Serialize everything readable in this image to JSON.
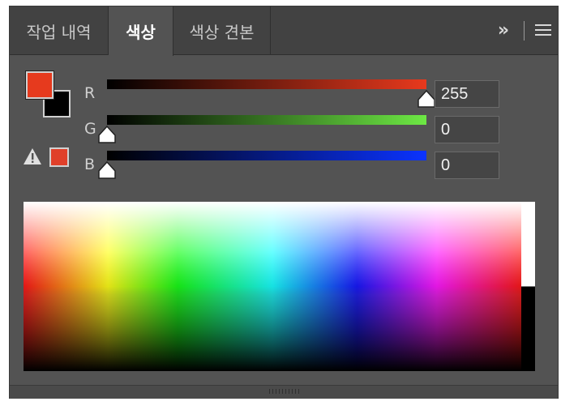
{
  "tabs": [
    {
      "label": "작업 내역",
      "active": false
    },
    {
      "label": "색상",
      "active": true
    },
    {
      "label": "색상 견본",
      "active": false
    }
  ],
  "header_icons": {
    "collapse": "double-chevron-right-icon",
    "menu": "hamburger-menu-icon"
  },
  "swatches": {
    "foreground_color": "#e63a1e",
    "background_color": "#000000",
    "gamut_warning_icon": "warning-triangle-icon",
    "gamut_color": "#e0402a"
  },
  "channels": [
    {
      "label": "R",
      "value": "255",
      "level": 1.0,
      "end_color": "#e8391d"
    },
    {
      "label": "G",
      "value": "0",
      "level": 0.0,
      "end_color": "#6de844"
    },
    {
      "label": "B",
      "value": "0",
      "level": 0.0,
      "end_color": "#0b33ff"
    }
  ]
}
